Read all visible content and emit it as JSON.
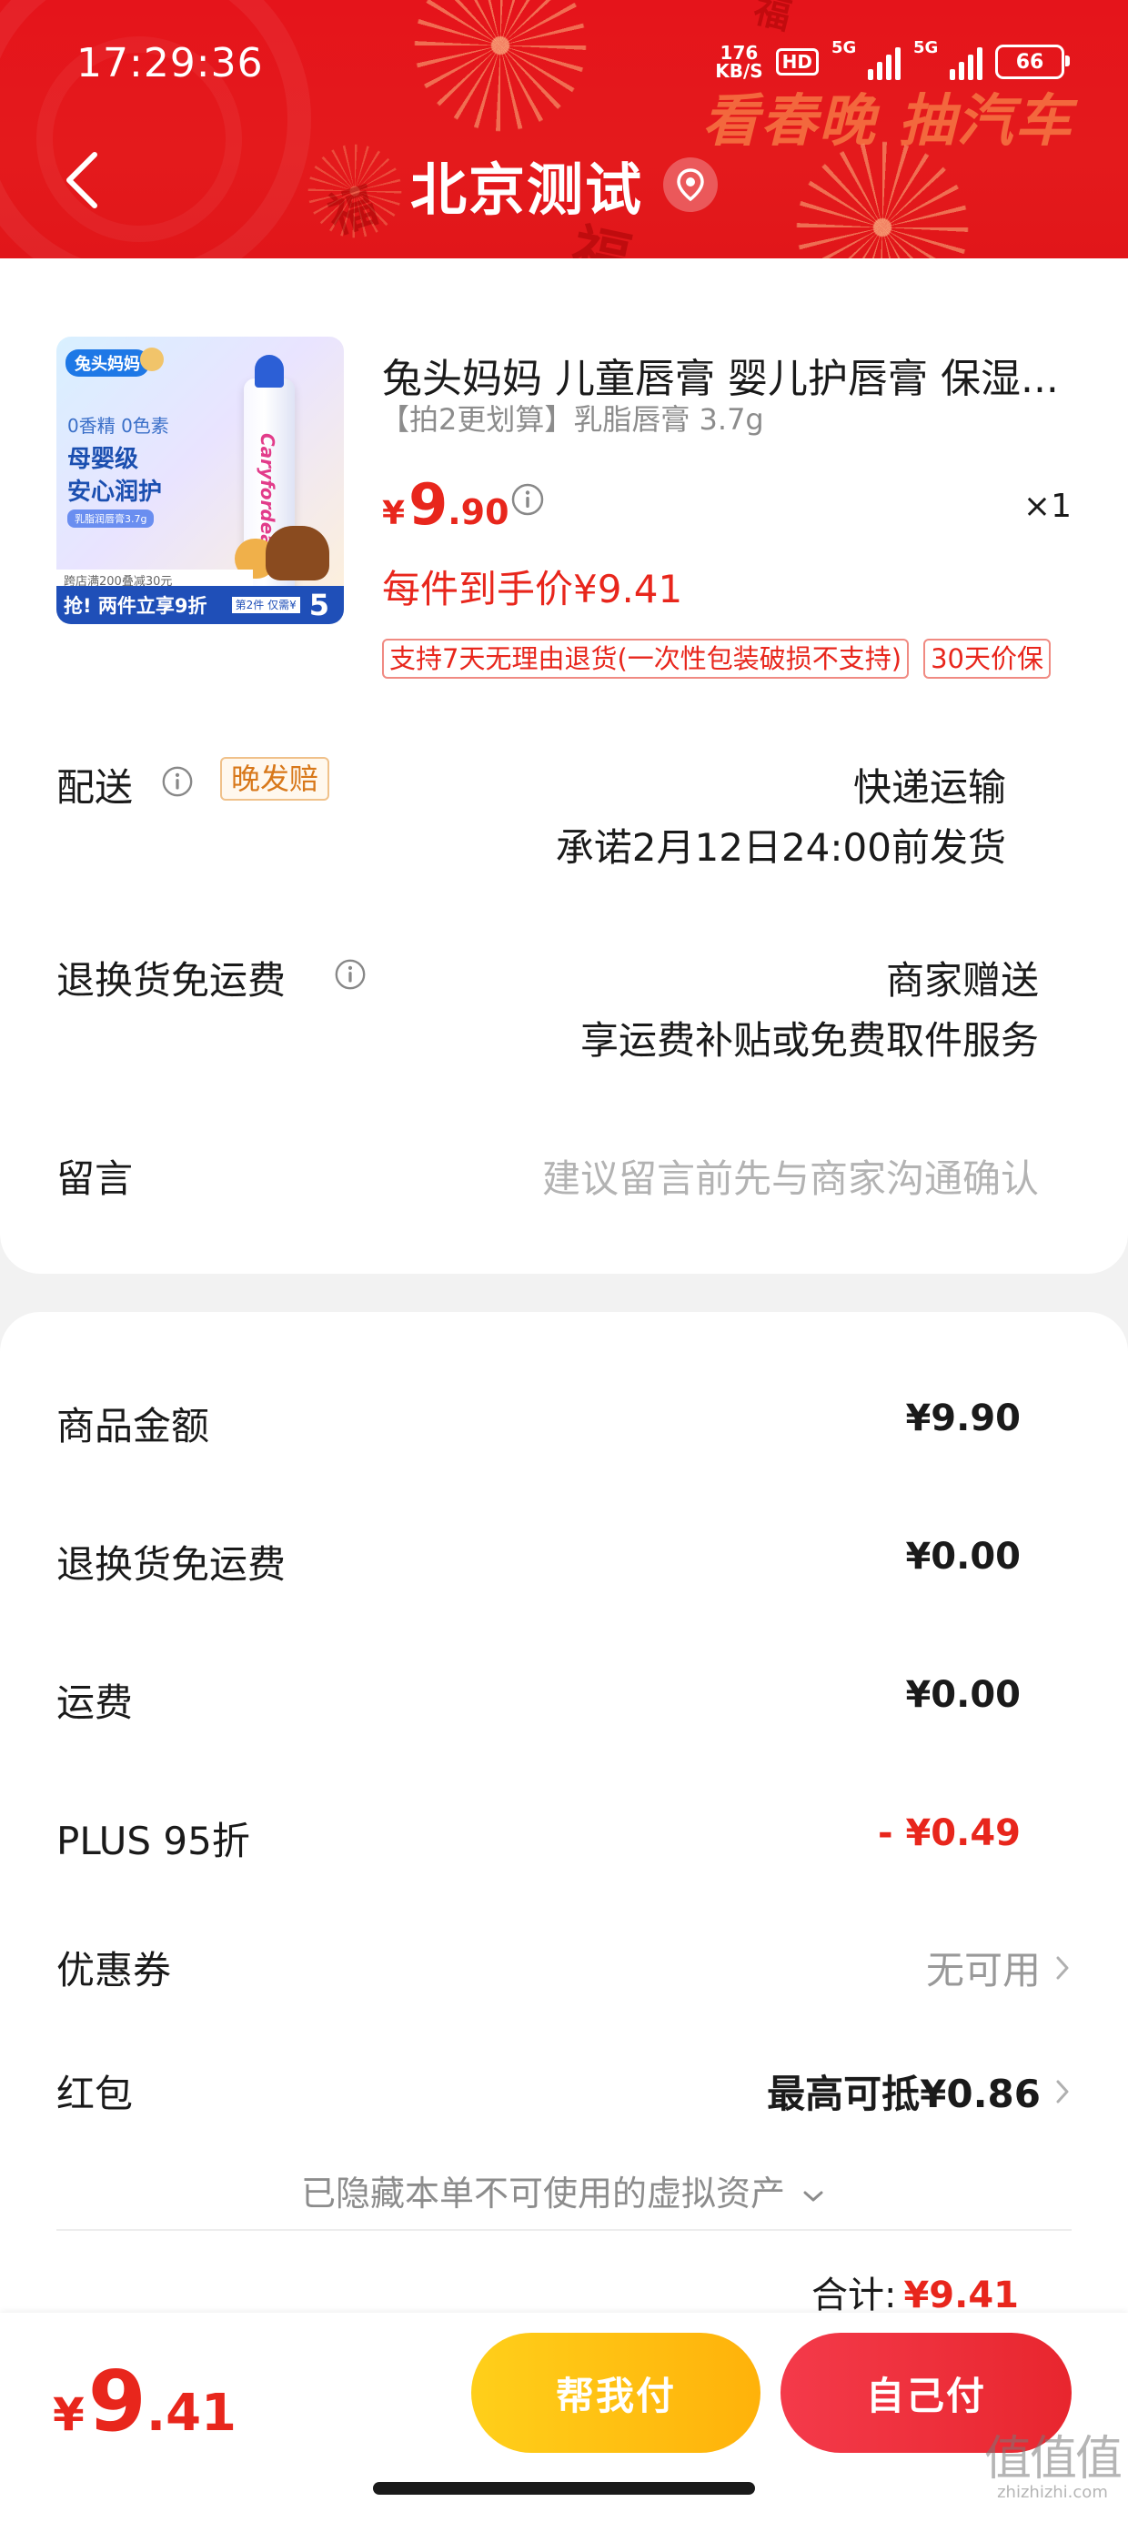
{
  "status_bar": {
    "time": "17:29:36",
    "net_speed_value": "176",
    "net_speed_unit": "KB/S",
    "hd_label": "HD",
    "signal1_label": "5G",
    "signal2_label": "5G",
    "battery": "66"
  },
  "header": {
    "title": "北京测试",
    "promo_text": "看春晚 抽汽车",
    "fu_char": "福",
    "back_icon": "chevron-left-icon",
    "location_icon": "location-pin-icon",
    "colors": {
      "header_red": "#e41a1c"
    }
  },
  "product": {
    "image": {
      "brand_chip": "兔头妈妈",
      "line1": "0香精 0色素",
      "line2": "母婴级",
      "line3": "安心润护",
      "small_chip": "乳脂润唇膏3.7g",
      "tube_text": "Caryfordeal",
      "strip_text": "跨店满200叠减30元",
      "bottom_text": "抢! 两件立享9折",
      "bottom_small": "第2件 仅需¥",
      "bottom_num": "5"
    },
    "title": "兔头妈妈 儿童唇膏 婴儿护唇膏 保湿...",
    "spec": "【拍2更划算】乳脂唇膏 3.7g",
    "price_symbol": "¥",
    "price_int": "9",
    "price_dec": ".90",
    "quantity": "×1",
    "final_price": "每件到手价¥9.41",
    "tags": [
      "支持7天无理由退货(一次性包装破损不支持)",
      "30天价保"
    ]
  },
  "delivery": {
    "label": "配送",
    "badge": "晚发赔",
    "method": "快递运输",
    "promise": "承诺2月12日24:00前发货"
  },
  "return_shipping": {
    "label": "退换货免运费",
    "provider": "商家赠送",
    "description": "享运费补贴或免费取件服务"
  },
  "message": {
    "label": "留言",
    "placeholder": "建议留言前先与商家沟通确认"
  },
  "summary": {
    "rows": [
      {
        "label": "商品金额",
        "value": "¥9.90"
      },
      {
        "label": "退换货免运费",
        "value": "¥0.00"
      },
      {
        "label": "运费",
        "value": "¥0.00"
      },
      {
        "label": "PLUS 95折",
        "value": "- ¥0.49"
      }
    ],
    "coupon": {
      "label": "优惠券",
      "value": "无可用"
    },
    "red_packet": {
      "label": "红包",
      "value": "最高可抵¥0.86"
    },
    "hidden_note": "已隐藏本单不可使用的虚拟资产",
    "total_label": "合计:",
    "total_value": "¥9.41",
    "discount_color": "#e8261c"
  },
  "bottom_bar": {
    "price_symbol": "¥",
    "price_int": "9",
    "price_dec": ".41",
    "help_pay_label": "帮我付",
    "self_pay_label": "自己付",
    "help_color": "#ffc012",
    "self_color": "#ef2e3c"
  },
  "watermark": {
    "logo": "值值值",
    "url": "zhizhizhi.com"
  }
}
